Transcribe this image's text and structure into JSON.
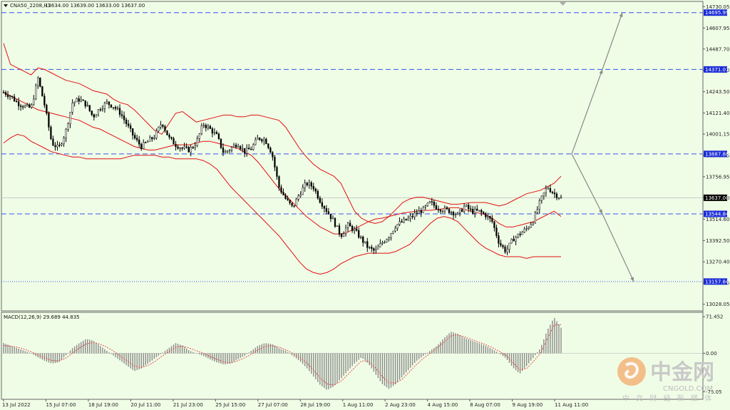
{
  "header": {
    "symbol_text": "CNA50_2208,H1",
    "ohlc_text": "13634.00 13639.00 13633.00 13637.00"
  },
  "macd_header": "MACD(12,26,9) 29.689 44.835",
  "watermark": {
    "cn": "中金网",
    "url": "CNGOLD.COM",
    "slogan": "中 文 财 经 新 媒 体"
  },
  "colors": {
    "background": "#f0fde6",
    "candle": "#000000",
    "bollinger": "#e01010",
    "level_line": "#3355ee",
    "level_box": "#1a2bd6",
    "current_box": "#000000",
    "arrow": "#888888",
    "macd_hist": "#8a8a8a",
    "macd_signal": "#e04040"
  },
  "chart_data": [
    {
      "type": "candlestick",
      "title": "CNA50_2208,H1",
      "ylim": [
        12990,
        14760
      ],
      "y_ticks": [
        "14730.05",
        "14607.95",
        "14487.70",
        "14365.60",
        "14243.50",
        "14121.40",
        "14001.15",
        "13879.05",
        "13756.95",
        "13636.70",
        "13514.60",
        "13392.50",
        "13270.40",
        "13150.15",
        "13028.05"
      ],
      "x_ticks": [
        "13 Jul 2022",
        "15 Jul 07:00",
        "18 Jul 19:00",
        "20 Jul 11:00",
        "21 Jul 23:00",
        "25 Jul 15:00",
        "27 Jul 07:00",
        "28 Jul 19:00",
        "1 Aug 11:00",
        "2 Aug 23:00",
        "4 Aug 15:00",
        "8 Aug 07:00",
        "9 Aug 19:00",
        "11 Aug 11:00"
      ],
      "horizontal_levels": [
        {
          "label": "14695.99",
          "value": 14695.99,
          "style": "dashed"
        },
        {
          "label": "14371.01",
          "value": 14371.01,
          "style": "dashed"
        },
        {
          "label": "13887.88",
          "value": 13887.88,
          "style": "dashed"
        },
        {
          "label": "13544.84",
          "value": 13544.84,
          "style": "dashed"
        },
        {
          "label": "13157.84",
          "value": 13157.84,
          "style": "dotted"
        }
      ],
      "current_price": {
        "label": "13637.00",
        "value": 13637.0
      },
      "close_path": [
        14240,
        14220,
        14180,
        14160,
        14150,
        14320,
        14160,
        13950,
        13920,
        14010,
        14180,
        14200,
        14170,
        14100,
        14150,
        14180,
        14160,
        14120,
        14050,
        13980,
        13930,
        13960,
        13990,
        14070,
        13980,
        13940,
        13920,
        13910,
        13950,
        14060,
        14030,
        13990,
        13890,
        13920,
        13950,
        13900,
        13920,
        13980,
        13970,
        13890,
        13700,
        13630,
        13580,
        13660,
        13720,
        13700,
        13620,
        13560,
        13500,
        13420,
        13480,
        13450,
        13400,
        13350,
        13330,
        13380,
        13420,
        13480,
        13500,
        13520,
        13550,
        13570,
        13610,
        13580,
        13570,
        13560,
        13540,
        13590,
        13560,
        13560,
        13540,
        13500,
        13380,
        13330,
        13400,
        13430,
        13460,
        13510,
        13620,
        13700,
        13660,
        13637
      ],
      "bollinger_upper": [
        14520,
        14400,
        14380,
        14360,
        14340,
        14380,
        14370,
        14350,
        14330,
        14310,
        14300,
        14290,
        14270,
        14250,
        14240,
        14230,
        14200,
        14180,
        14170,
        14140,
        14100,
        14060,
        14020,
        14000,
        14060,
        14120,
        14130,
        14100,
        14070,
        14080,
        14090,
        14100,
        14110,
        14110,
        14100,
        14100,
        14110,
        14110,
        14100,
        14090,
        14080,
        14040,
        13980,
        13920,
        13870,
        13830,
        13800,
        13780,
        13760,
        13720,
        13640,
        13560,
        13520,
        13500,
        13490,
        13500,
        13530,
        13570,
        13610,
        13630,
        13640,
        13640,
        13630,
        13620,
        13610,
        13600,
        13600,
        13605,
        13610,
        13610,
        13610,
        13600,
        13590,
        13600,
        13620,
        13640,
        13660,
        13670,
        13680,
        13700,
        13720,
        13760
      ],
      "bollinger_middle": [
        14240,
        14220,
        14200,
        14180,
        14160,
        14140,
        14130,
        14120,
        14110,
        14100,
        14090,
        14080,
        14060,
        14040,
        14030,
        14010,
        13990,
        13970,
        13950,
        13930,
        13920,
        13910,
        13910,
        13920,
        13930,
        13940,
        13940,
        13940,
        13950,
        13960,
        13960,
        13950,
        13940,
        13930,
        13920,
        13900,
        13880,
        13840,
        13790,
        13740,
        13690,
        13650,
        13610,
        13570,
        13530,
        13500,
        13470,
        13450,
        13430,
        13430,
        13440,
        13460,
        13480,
        13500,
        13515,
        13520,
        13530,
        13540,
        13550,
        13555,
        13560,
        13565,
        13565,
        13570,
        13575,
        13580,
        13580,
        13570,
        13560,
        13550,
        13540,
        13520,
        13490,
        13470,
        13470,
        13480,
        13490,
        13500,
        13520,
        13540,
        13560,
        13530
      ],
      "bollinger_lower": [
        13950,
        13980,
        14000,
        13990,
        13960,
        13940,
        13920,
        13900,
        13890,
        13880,
        13870,
        13870,
        13860,
        13860,
        13860,
        13860,
        13860,
        13860,
        13870,
        13880,
        13880,
        13880,
        13880,
        13870,
        13870,
        13860,
        13860,
        13860,
        13860,
        13850,
        13830,
        13800,
        13750,
        13700,
        13660,
        13620,
        13580,
        13540,
        13500,
        13460,
        13420,
        13370,
        13320,
        13270,
        13230,
        13210,
        13200,
        13210,
        13230,
        13260,
        13280,
        13300,
        13310,
        13320,
        13320,
        13320,
        13320,
        13330,
        13350,
        13370,
        13410,
        13450,
        13490,
        13520,
        13530,
        13520,
        13500,
        13460,
        13420,
        13380,
        13350,
        13330,
        13310,
        13300,
        13300,
        13300,
        13290,
        13300,
        13300,
        13300,
        13300,
        13300
      ],
      "projection": {
        "origin": 13887.88,
        "up_targets": [
          14371.01,
          14695.99
        ],
        "down_targets": [
          13544.84,
          13157.84
        ]
      }
    },
    {
      "type": "bar",
      "title": "MACD(12,26,9)",
      "y_ticks": [
        "71.452",
        "0.00",
        "-75.05"
      ],
      "ylim": [
        -90,
        80
      ],
      "histogram": [
        20,
        15,
        10,
        5,
        0,
        -8,
        -15,
        -20,
        -18,
        -5,
        10,
        20,
        28,
        25,
        15,
        5,
        -5,
        -15,
        -25,
        -35,
        -30,
        -20,
        -10,
        0,
        10,
        20,
        15,
        5,
        0,
        -5,
        -12,
        -18,
        -22,
        -20,
        -12,
        -5,
        5,
        15,
        20,
        18,
        10,
        5,
        -5,
        -15,
        -28,
        -45,
        -62,
        -72,
        -65,
        -50,
        -35,
        -20,
        -8,
        -20,
        -40,
        -60,
        -70,
        -60,
        -45,
        -30,
        -15,
        -5,
        5,
        15,
        30,
        42,
        38,
        30,
        25,
        20,
        15,
        8,
        0,
        -10,
        -28,
        -40,
        -25,
        -8,
        10,
        45,
        70,
        50
      ],
      "signal": [
        15,
        14,
        12,
        8,
        3,
        -3,
        -9,
        -14,
        -15,
        -10,
        0,
        10,
        18,
        21,
        18,
        12,
        4,
        -6,
        -15,
        -25,
        -28,
        -24,
        -16,
        -6,
        3,
        12,
        14,
        10,
        5,
        0,
        -6,
        -12,
        -17,
        -19,
        -15,
        -9,
        -2,
        7,
        13,
        15,
        12,
        7,
        0,
        -8,
        -18,
        -32,
        -48,
        -60,
        -62,
        -55,
        -42,
        -28,
        -15,
        -16,
        -28,
        -45,
        -58,
        -58,
        -50,
        -36,
        -22,
        -10,
        0,
        10,
        22,
        34,
        36,
        32,
        27,
        22,
        17,
        11,
        4,
        -4,
        -18,
        -32,
        -30,
        -16,
        0,
        28,
        55,
        56
      ]
    }
  ]
}
